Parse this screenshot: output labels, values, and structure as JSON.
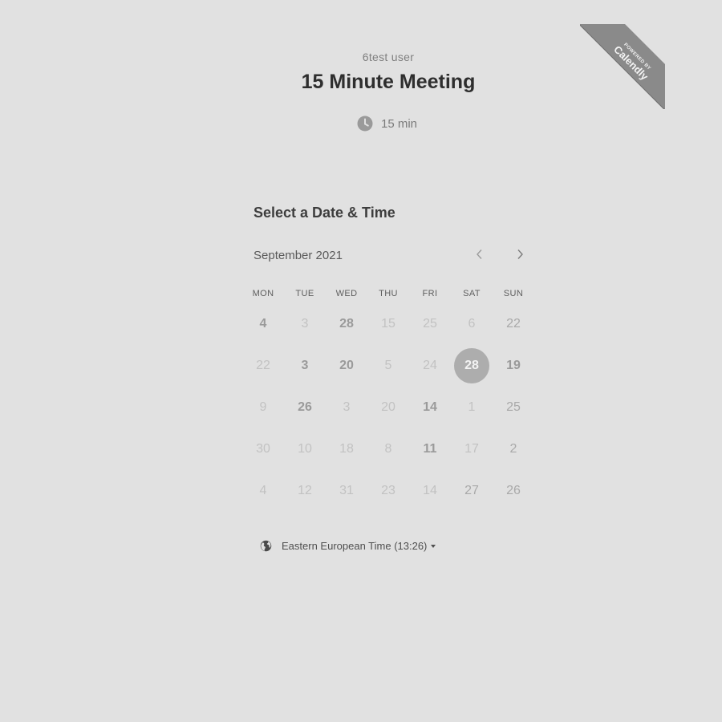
{
  "header": {
    "user": "6test user",
    "title": "15 Minute Meeting",
    "duration": "15 min",
    "icon": "clock-icon"
  },
  "ribbon": {
    "line1": "POWERED BY",
    "line2": "Calendly"
  },
  "calendar": {
    "section_title": "Select a Date & Time",
    "month": "September 2021",
    "prev_icon": "chevron-left-icon",
    "next_icon": "chevron-right-icon",
    "weekdays": [
      "MON",
      "TUE",
      "WED",
      "THU",
      "FRI",
      "SAT",
      "SUN"
    ],
    "weeks": [
      [
        {
          "label": "4",
          "state": "available"
        },
        {
          "label": "3",
          "state": "disabled"
        },
        {
          "label": "28",
          "state": "available"
        },
        {
          "label": "15",
          "state": "disabled"
        },
        {
          "label": "25",
          "state": "disabled"
        },
        {
          "label": "6",
          "state": "disabled"
        },
        {
          "label": "22",
          "state": "muted"
        }
      ],
      [
        {
          "label": "22",
          "state": "disabled"
        },
        {
          "label": "3",
          "state": "available"
        },
        {
          "label": "20",
          "state": "available"
        },
        {
          "label": "5",
          "state": "disabled"
        },
        {
          "label": "24",
          "state": "disabled"
        },
        {
          "label": "28",
          "state": "selected"
        },
        {
          "label": "19",
          "state": "available"
        }
      ],
      [
        {
          "label": "9",
          "state": "disabled"
        },
        {
          "label": "26",
          "state": "available"
        },
        {
          "label": "3",
          "state": "disabled"
        },
        {
          "label": "20",
          "state": "disabled"
        },
        {
          "label": "14",
          "state": "available"
        },
        {
          "label": "1",
          "state": "disabled"
        },
        {
          "label": "25",
          "state": "muted"
        }
      ],
      [
        {
          "label": "30",
          "state": "disabled"
        },
        {
          "label": "10",
          "state": "disabled"
        },
        {
          "label": "18",
          "state": "disabled"
        },
        {
          "label": "8",
          "state": "disabled"
        },
        {
          "label": "11",
          "state": "available"
        },
        {
          "label": "17",
          "state": "disabled"
        },
        {
          "label": "2",
          "state": "muted"
        }
      ],
      [
        {
          "label": "4",
          "state": "disabled"
        },
        {
          "label": "12",
          "state": "disabled"
        },
        {
          "label": "31",
          "state": "disabled"
        },
        {
          "label": "23",
          "state": "disabled"
        },
        {
          "label": "14",
          "state": "disabled"
        },
        {
          "label": "27",
          "state": "muted"
        },
        {
          "label": "26",
          "state": "muted"
        }
      ]
    ]
  },
  "timezone": {
    "label": "Eastern European Time (13:26)",
    "icon": "globe-icon"
  },
  "colors": {
    "background": "#e1e1e1",
    "selected_day": "#adadad",
    "ribbon": "#8a8a8a"
  }
}
